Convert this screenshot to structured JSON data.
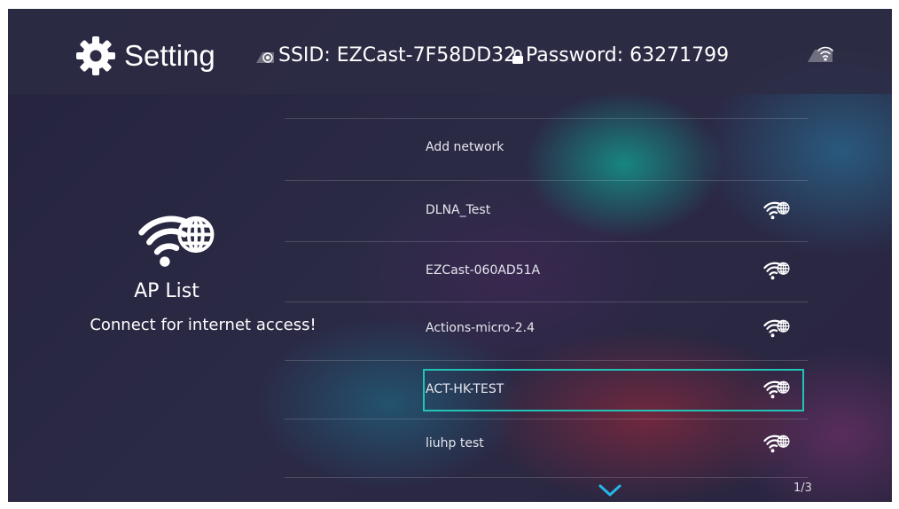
{
  "header": {
    "title": "Setting",
    "ssid_text": "SSID: EZCast-7F58DD32",
    "password_text": "Password: 63271799",
    "icons": {
      "settings": "gear-icon",
      "ssid": "ssid-broadcast-icon",
      "password": "lock-icon",
      "connection_status": "wifi-status-icon"
    }
  },
  "left_panel": {
    "icon": "wifi-globe-icon",
    "title": "AP List",
    "subtitle": "Connect for internet access!"
  },
  "networks": [
    {
      "name": "Add network",
      "icon": null
    },
    {
      "name": "DLNA_Test",
      "icon": "wifi-globe-icon"
    },
    {
      "name": "EZCast-060AD51A",
      "icon": "wifi-globe-icon"
    },
    {
      "name": "Actions-micro-2.4",
      "icon": "wifi-globe-icon"
    },
    {
      "name": "ACT-HK-TEST",
      "icon": "wifi-globe-icon",
      "selected": true
    },
    {
      "name": "liuhp test",
      "icon": "wifi-globe-icon"
    }
  ],
  "footer": {
    "scroll_icon": "chevron-down-icon",
    "page_indicator": "1/3"
  },
  "colors": {
    "selection_border": "#23c2b6",
    "header_bg": "#2d2c44",
    "text": "#ffffff"
  }
}
